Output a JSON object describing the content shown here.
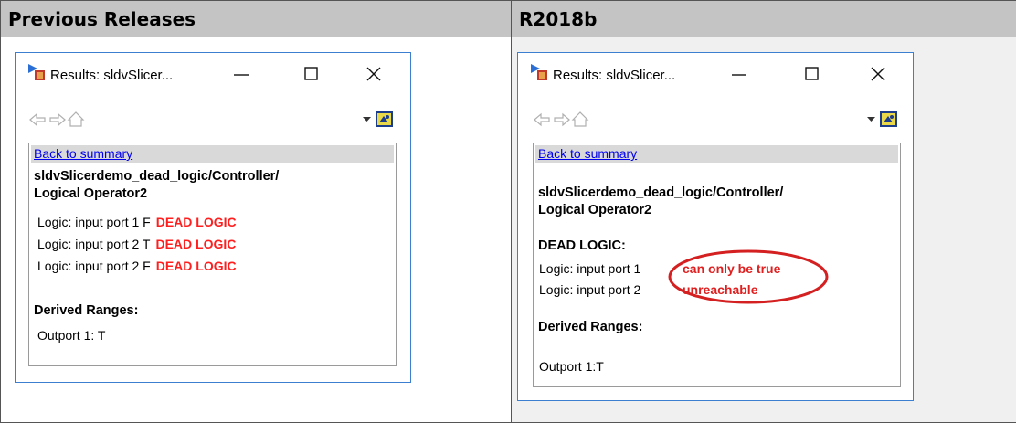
{
  "headers": {
    "left": "Previous Releases",
    "right": "R2018b"
  },
  "window": {
    "title": "Results: sldvSlicer...",
    "minimize_glyph": "—",
    "maximize_glyph": "☐",
    "close_glyph": "✕"
  },
  "left_panel": {
    "back_link": "Back to summary",
    "block_path_line1": "sldvSlicerdemo_dead_logic/Controller/",
    "block_path_line2": "Logical Operator2",
    "logic_rows": [
      {
        "text": "Logic: input port 1 F",
        "status": "DEAD LOGIC"
      },
      {
        "text": "Logic: input port 2 T",
        "status": "DEAD LOGIC"
      },
      {
        "text": "Logic: input port 2 F",
        "status": "DEAD LOGIC"
      }
    ],
    "derived_ranges_heading": "Derived Ranges:",
    "outport": "Outport 1: T"
  },
  "right_panel": {
    "back_link": "Back to summary",
    "block_path_line1": "sldvSlicerdemo_dead_logic/Controller/",
    "block_path_line2": "Logical Operator2",
    "dead_logic_heading": "DEAD LOGIC:",
    "logic_rows": [
      {
        "text": "Logic: input port 1",
        "status": "can only be true"
      },
      {
        "text": "Logic: input port 2",
        "status": "unreachable"
      }
    ],
    "derived_ranges_heading": "Derived Ranges:",
    "outport": "Outport 1:T"
  },
  "colors": {
    "dead_logic": "#ff1f1f",
    "highlight_ellipse": "#d42020",
    "window_border": "#3c7fd0",
    "header_bg": "#c4c4c4"
  },
  "icons": [
    "results-app-icon",
    "minimize-icon",
    "maximize-icon",
    "close-icon",
    "back-arrow-icon",
    "forward-arrow-icon",
    "home-icon",
    "dropdown-arrow-icon",
    "highlight-model-icon"
  ]
}
